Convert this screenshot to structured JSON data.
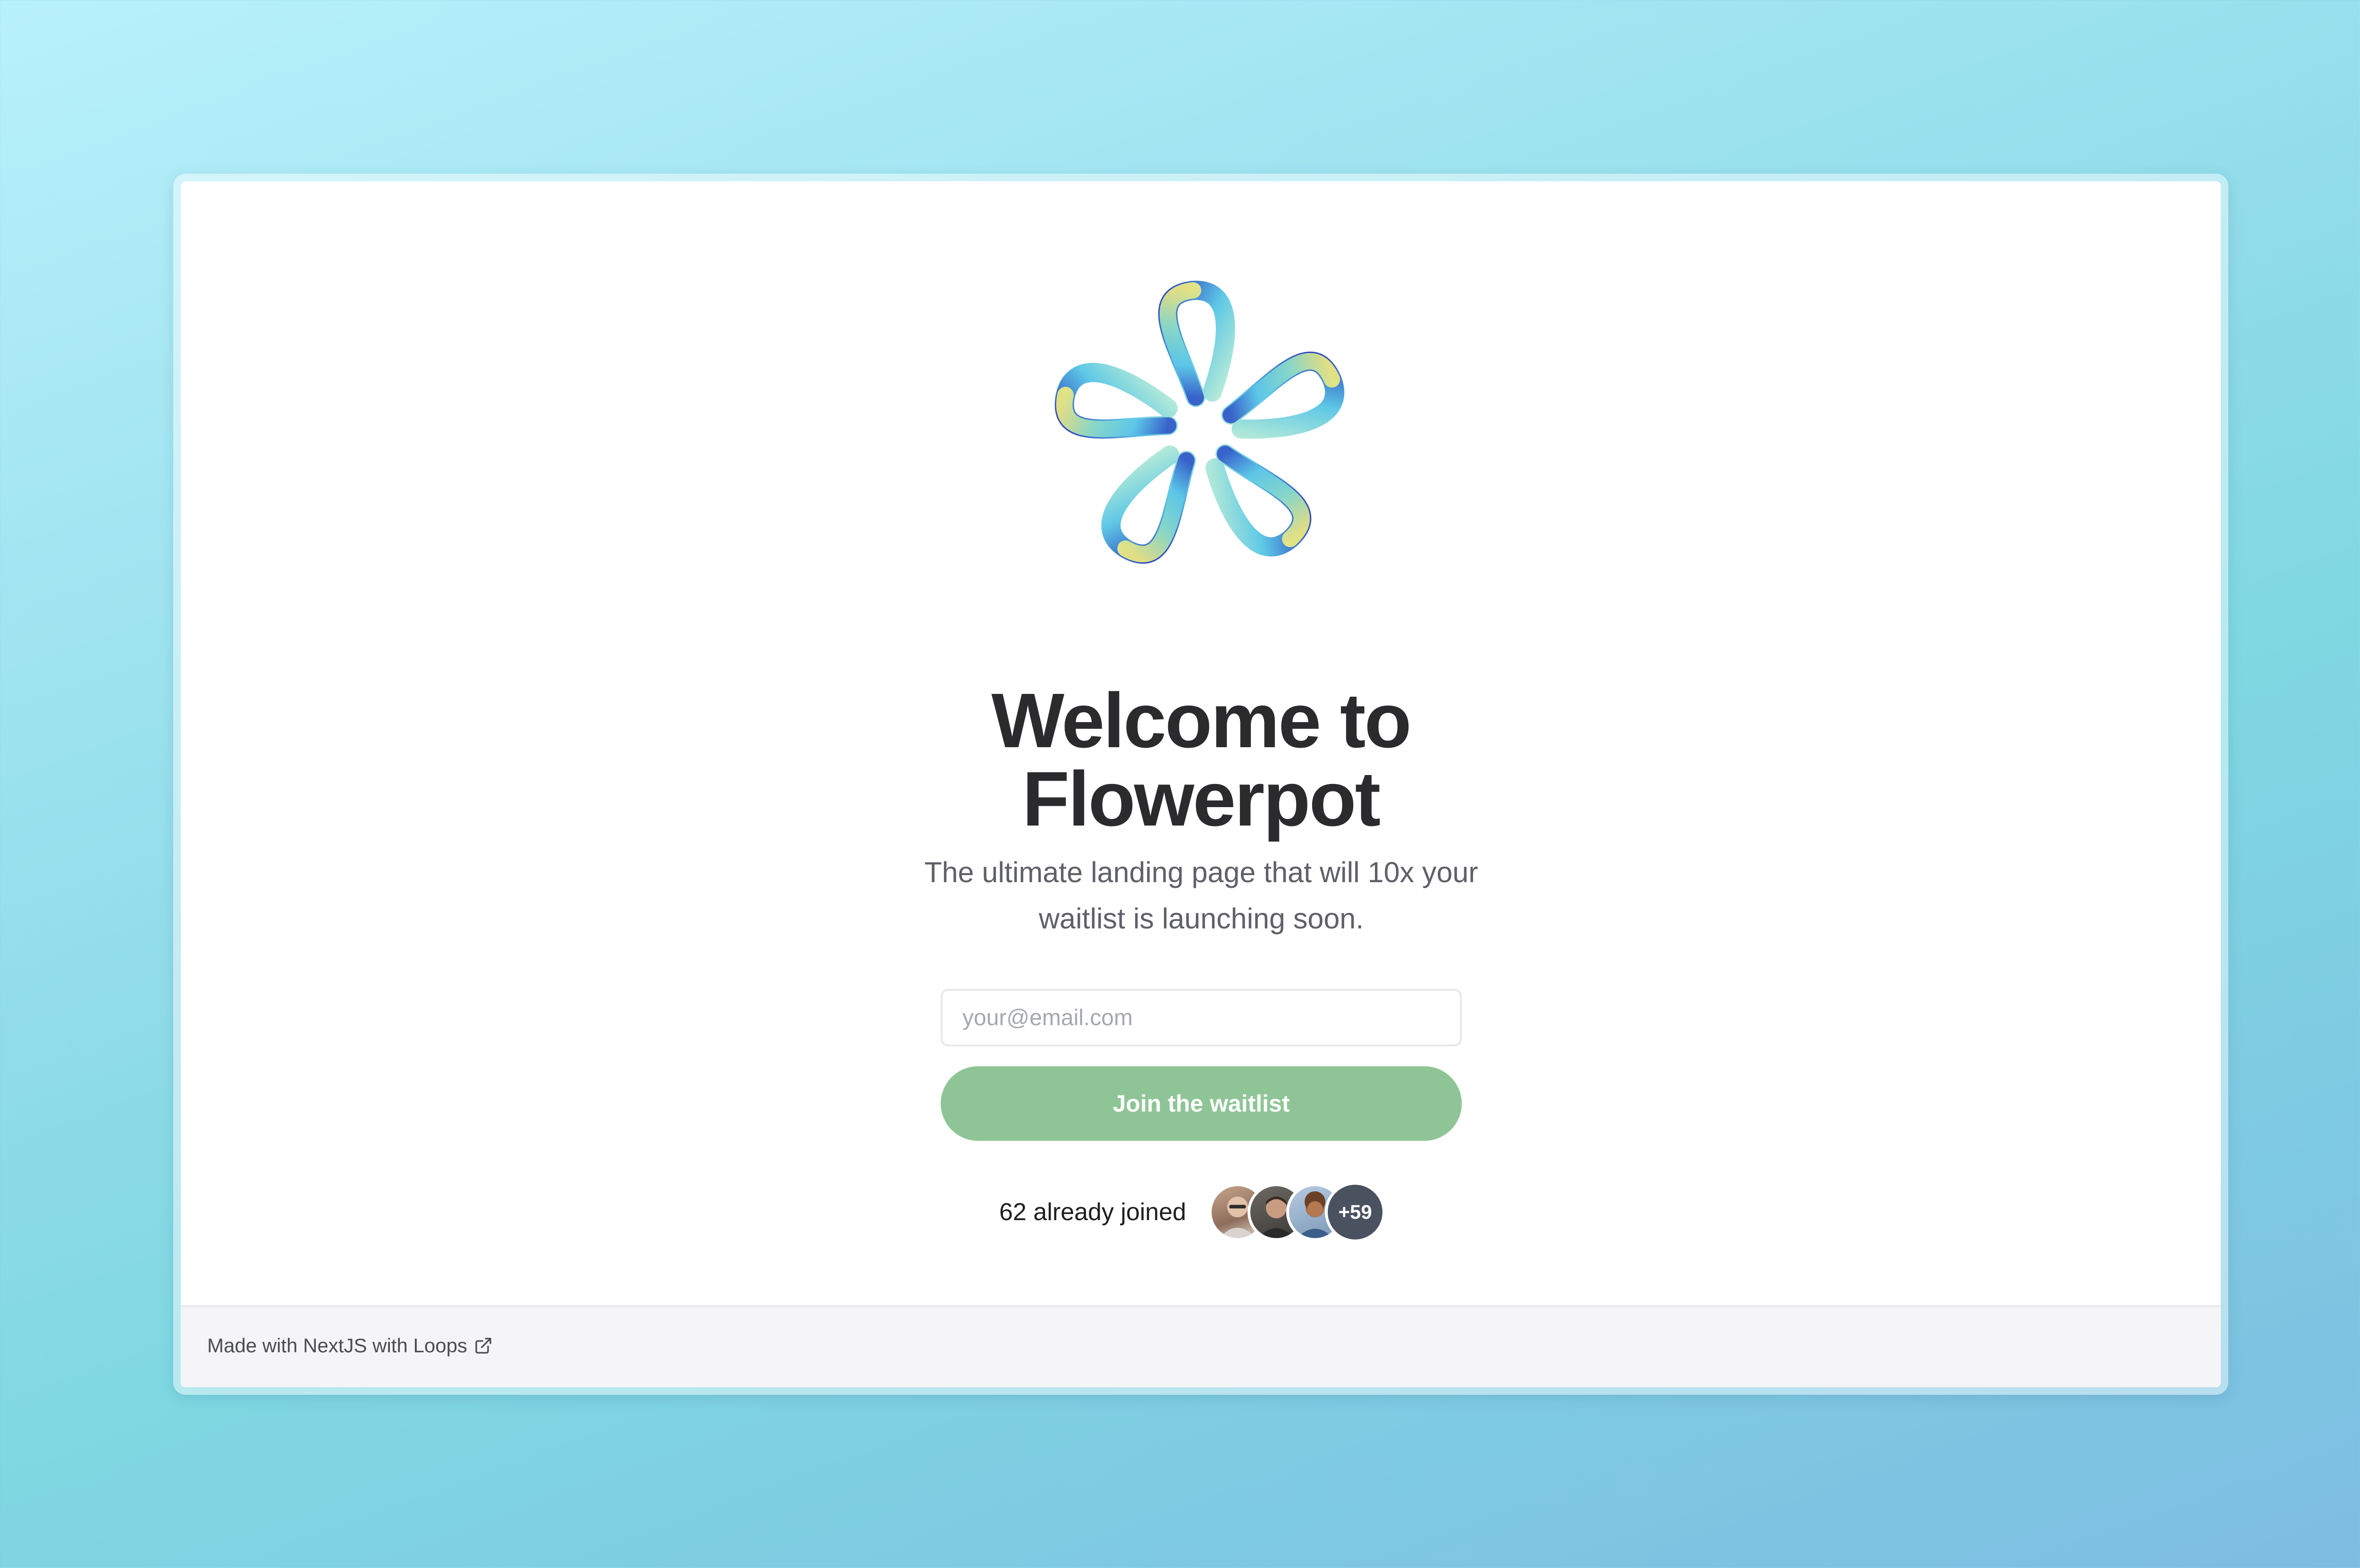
{
  "hero": {
    "title_line1": "Welcome to",
    "title_line2": "Flowerpot",
    "subtitle": "The ultimate landing page that will 10x your waitlist is launching soon."
  },
  "form": {
    "email_placeholder": "your@email.com",
    "email_value": "",
    "submit_label": "Join the waitlist"
  },
  "social_proof": {
    "joined_text": "62 already joined",
    "extra_count_label": "+59",
    "avatars": [
      "avatar-1",
      "avatar-2",
      "avatar-3"
    ]
  },
  "footer": {
    "credit_text": "Made with NextJS with Loops",
    "link_icon": "external-link-icon"
  },
  "colors": {
    "button_green": "#8fc596",
    "title_dark": "#2b2b2e",
    "count_badge": "#4a5260"
  }
}
